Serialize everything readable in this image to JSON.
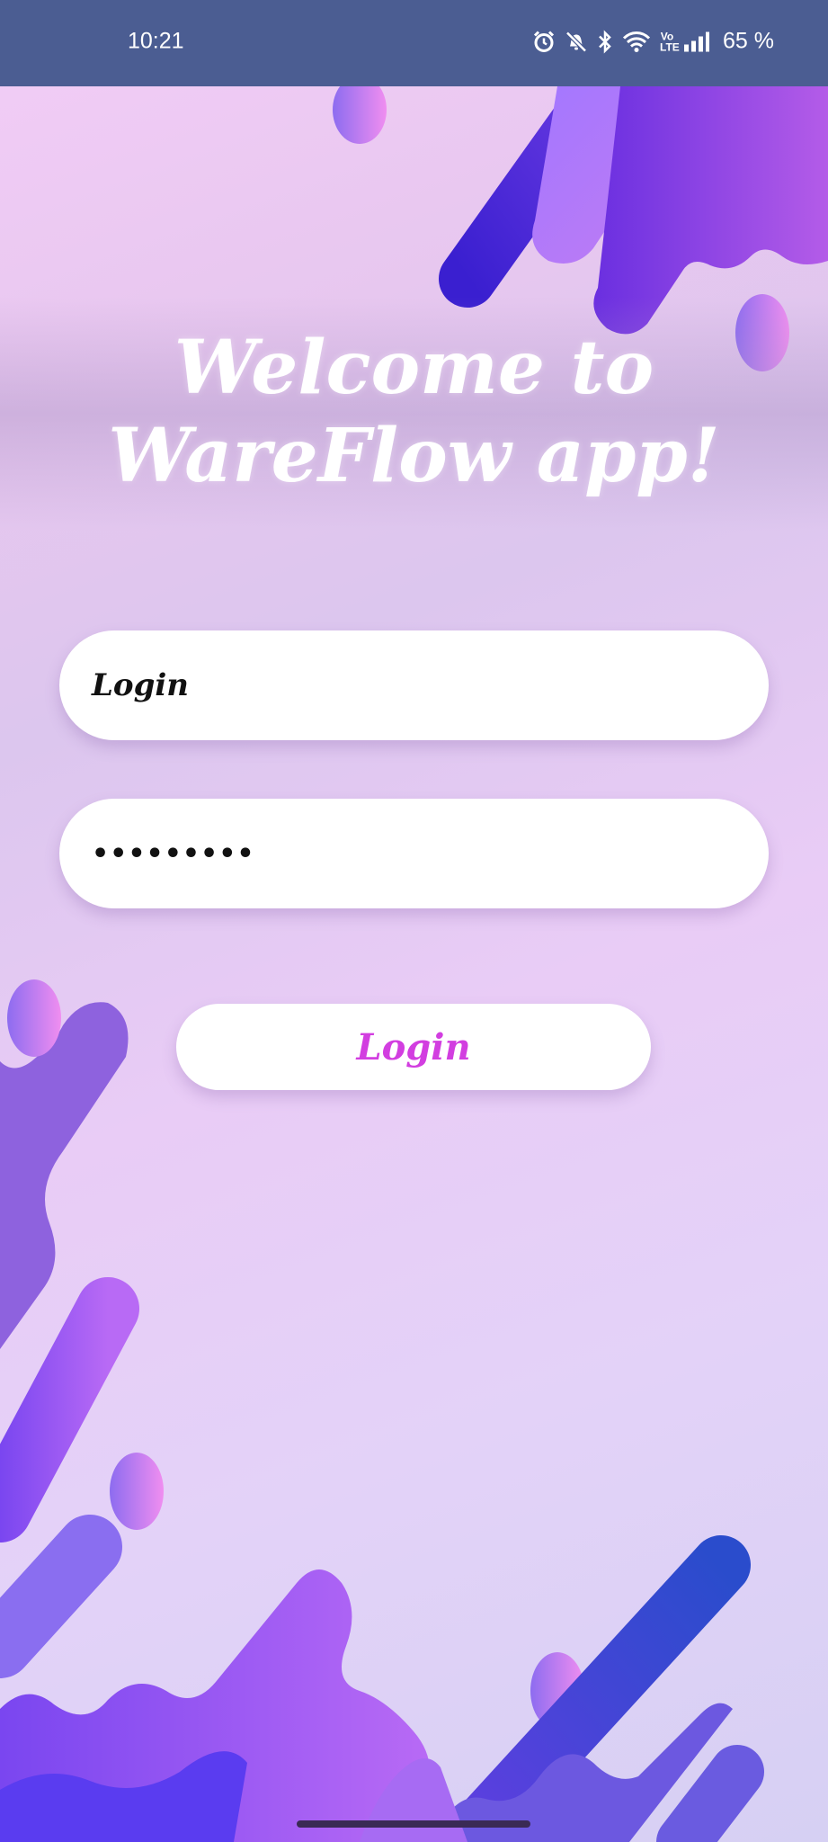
{
  "status_bar": {
    "time": "10:21",
    "battery": "65 %",
    "volte": "Vo LTE",
    "icons": [
      "alarm-icon",
      "mute-icon",
      "bluetooth-icon",
      "wifi-icon",
      "volte-icon",
      "signal-icon"
    ]
  },
  "welcome": {
    "line1": "Welcome to",
    "line2": "WareFlow app!"
  },
  "form": {
    "login_value": "Login",
    "password_value": "•••••••••",
    "submit_label": "Login"
  },
  "colors": {
    "status_bar": "#4b5d92",
    "button_text": "#d23ee0",
    "accent_purple": "#8a3be8",
    "accent_blue": "#4a3ee8"
  }
}
